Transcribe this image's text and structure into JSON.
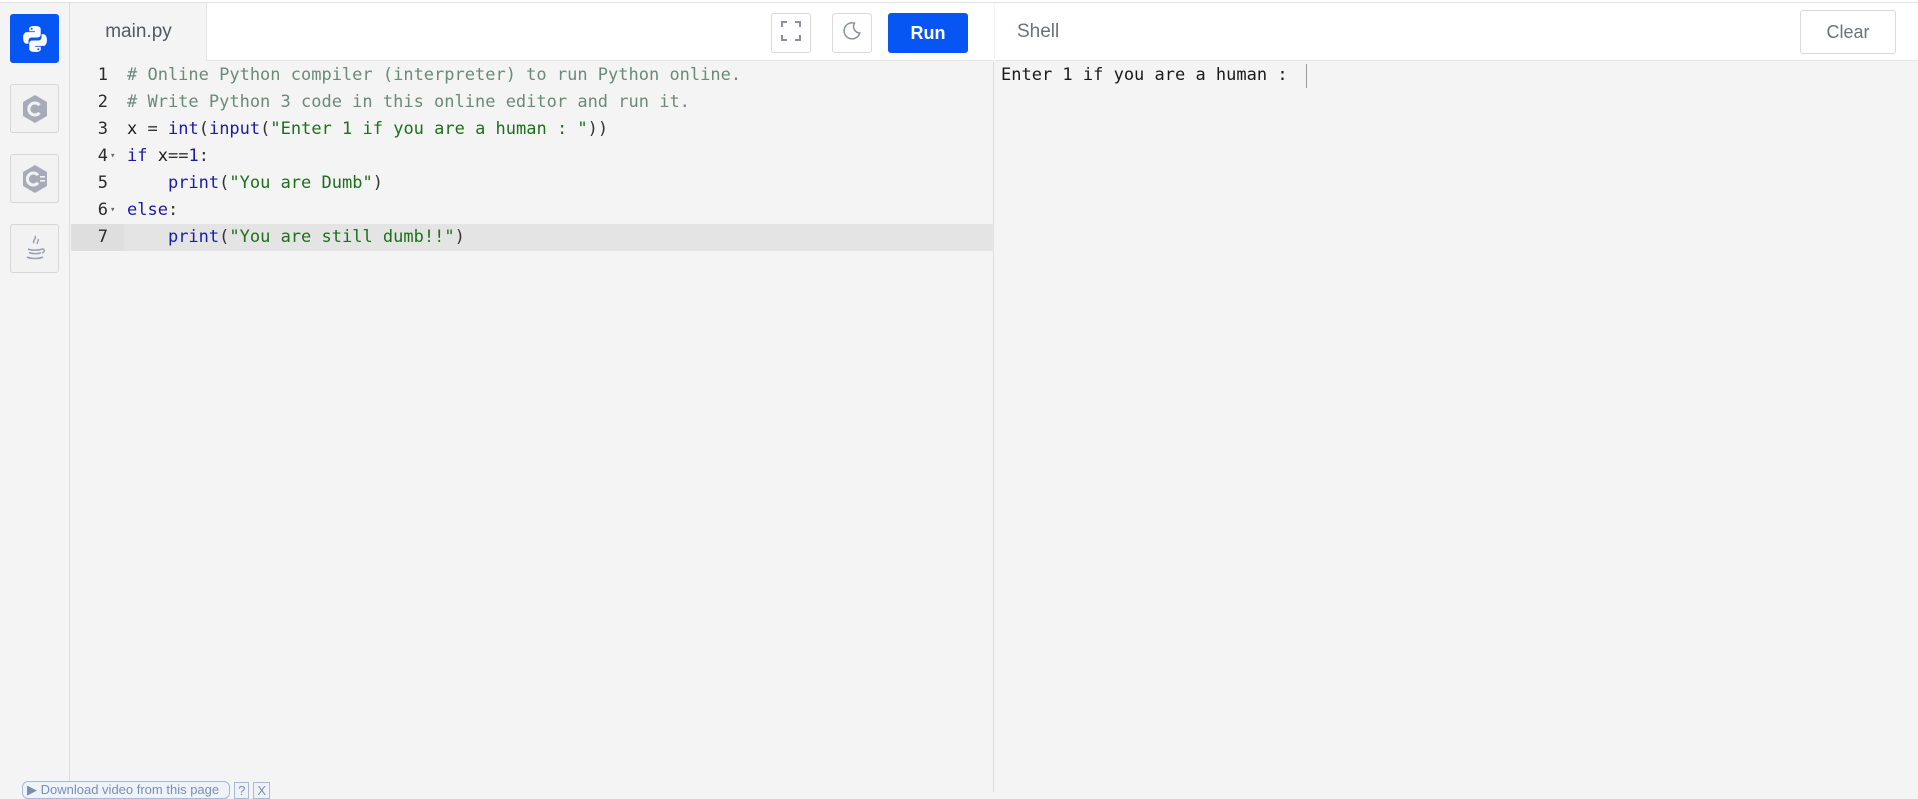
{
  "sidebar": {
    "languages": [
      {
        "name": "python-icon",
        "active": true
      },
      {
        "name": "c-icon",
        "active": false
      },
      {
        "name": "cpp-icon",
        "active": false
      },
      {
        "name": "java-icon",
        "active": false
      }
    ]
  },
  "editor": {
    "tab_label": "main.py",
    "fullscreen_icon": "fullscreen-icon",
    "theme_icon": "moon-icon",
    "run_label": "Run",
    "lines": [
      {
        "num": "1",
        "text": "# Online Python compiler (interpreter) to run Python online."
      },
      {
        "num": "2",
        "text": "# Write Python 3 code in this online editor and run it."
      },
      {
        "num": "3",
        "text": "x = int(input(\"Enter 1 if you are a human : \"))"
      },
      {
        "num": "4",
        "text": "if x==1:"
      },
      {
        "num": "5",
        "text": "    print(\"You are Dumb\")"
      },
      {
        "num": "6",
        "text": "else:"
      },
      {
        "num": "7",
        "text": "    print(\"You are still dumb!!\")"
      }
    ]
  },
  "shell": {
    "title": "Shell",
    "clear_label": "Clear",
    "output": "Enter 1 if you are a human : "
  },
  "download_bar": {
    "label": "Download video from this page",
    "help": "?",
    "close": "X"
  },
  "colors": {
    "accent": "#0556f3",
    "background": "#f4f4f4"
  }
}
